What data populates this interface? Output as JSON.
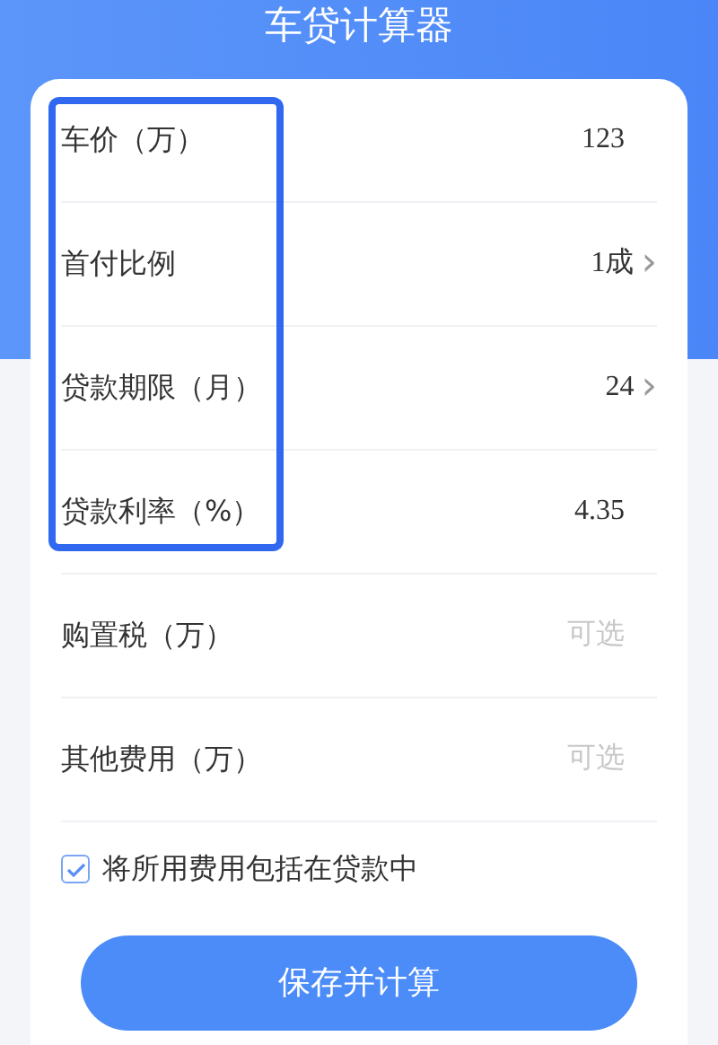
{
  "title": "车贷计算器",
  "fields": [
    {
      "label": "车价（万）",
      "kind": "input",
      "value": "123",
      "highlighted": true
    },
    {
      "label": "首付比例",
      "kind": "select",
      "value": "1成",
      "chevron": "›",
      "highlighted": true
    },
    {
      "label": "贷款期限（月）",
      "kind": "select",
      "value": "24",
      "chevron": "›",
      "highlighted": true
    },
    {
      "label": "贷款利率（%）",
      "kind": "input",
      "value": "4.35",
      "highlighted": true
    },
    {
      "label": "购置税（万）",
      "kind": "input",
      "placeholder": "可选",
      "highlighted": false
    },
    {
      "label": "其他费用（万）",
      "kind": "input",
      "placeholder": "可选",
      "highlighted": false
    }
  ],
  "include_fees": {
    "label": "将所用费用包括在贷款中",
    "checked": true
  },
  "button": "保存并计算"
}
